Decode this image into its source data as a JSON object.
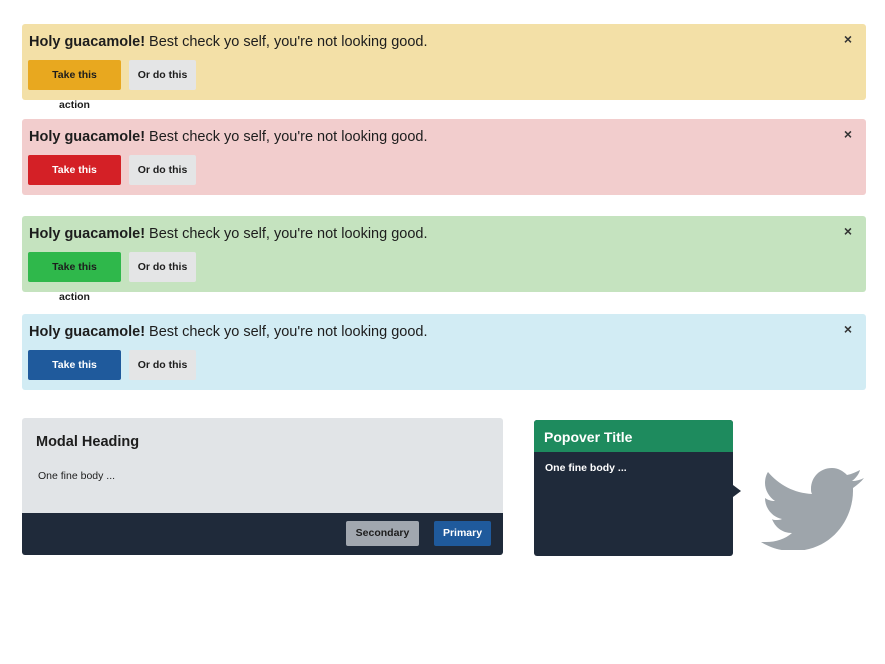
{
  "alerts": [
    {
      "strong": "Holy guacamole!",
      "text": " Best check yo self, you're not looking good.",
      "close": "×",
      "primary_label": "Take this action",
      "secondary_label": "Or do this",
      "accent": "#e8a81f"
    },
    {
      "strong": "Holy guacamole!",
      "text": " Best check yo self, you're not looking good.",
      "close": "×",
      "primary_label": "Take this action",
      "secondary_label": "Or do this",
      "accent": "#d42026"
    },
    {
      "strong": "Holy guacamole!",
      "text": " Best check yo self, you're not looking good.",
      "close": "×",
      "primary_label": "Take this action",
      "secondary_label": "Or do this",
      "accent": "#2fb84b"
    },
    {
      "strong": "Holy guacamole!",
      "text": " Best check yo self, you're not looking good.",
      "close": "×",
      "primary_label": "Take this action",
      "secondary_label": "Or do this",
      "accent": "#1f5a9c"
    }
  ],
  "modal": {
    "heading": "Modal Heading",
    "body": "One fine body ...",
    "secondary_label": "Secondary",
    "primary_label": "Primary"
  },
  "popover": {
    "title": "Popover Title",
    "body": "One fine body ..."
  },
  "decor": {
    "bird_icon": "twitter-bird-icon",
    "bird_color": "#9ea5ab"
  }
}
